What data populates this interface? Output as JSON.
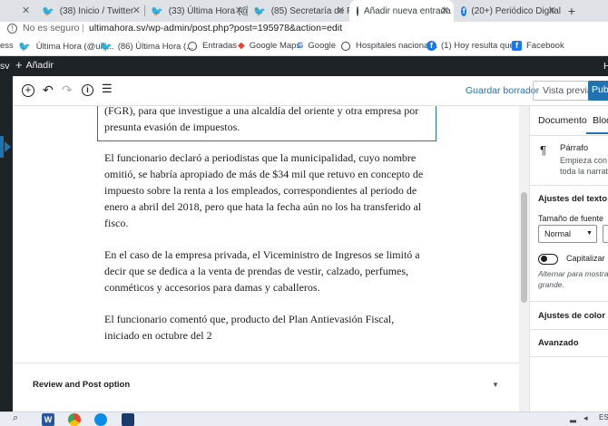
{
  "browser": {
    "tabs": [
      {
        "title": "(38) Inicio / Twitter",
        "icon": "twitter-icon"
      },
      {
        "title": "(33) Última Hora (@ult",
        "icon": "twitter-icon"
      },
      {
        "title": "(85) Secretaría de Pren",
        "icon": "twitter-icon"
      },
      {
        "title": "Añadir nueva entrada ‹",
        "icon": "wordpress-icon"
      },
      {
        "title": "(20+) Periódico Digital",
        "icon": "facebook-icon"
      }
    ],
    "new_tab": "+",
    "security_label": "No es seguro",
    "url": "ultimahora.sv/wp-admin/post.php?post=195978&action=edit",
    "bookmarks": [
      {
        "label": "ess"
      },
      {
        "label": "Última Hora (@ulti...",
        "icon": "twitter-icon"
      },
      {
        "label": "(86) Última Hora (...",
        "icon": "twitter-icon"
      },
      {
        "label": "Entradas",
        "icon": "wordpress-icon"
      },
      {
        "label": "Google Maps",
        "icon": "maps-icon"
      },
      {
        "label": "Google",
        "icon": "google-icon"
      },
      {
        "label": "Hospitales nacional...",
        "icon": "wordpress-icon"
      },
      {
        "label": "(1) Hoy resulta que...",
        "icon": "facebook-icon"
      },
      {
        "label": "Facebook",
        "icon": "facebook-icon"
      }
    ]
  },
  "admin_bar": {
    "left_fragment": "sv",
    "add_new": "Añadir",
    "right_fragment": "H"
  },
  "editor_header": {
    "save_draft": "Guardar borrador",
    "preview": "Vista previa",
    "publish": "Pub"
  },
  "content": {
    "selected_paragraph": "(FGR), para que investigue a una alcaldía del oriente y otra empresa por presunta evasión de impuestos.",
    "paragraphs": [
      "El funcionario declaró a periodistas que la municipalidad, cuyo nombre omitió, se habría apropiado de más de $34 mil que retuvo en concepto de impuesto sobre la renta a los empleados, correspondientes al periodo de enero a abril del 2018, pero que hata la fecha aún no los ha transferido al fisco.",
      "En el caso de la empresa privada, el Viceministro de Ingresos se limitó a decir que se dedica a la venta de prendas de vestir, calzado, perfumes, conméticos y accesorios para damas y caballeros.",
      "El funcionario comentó que, producto del Plan Antievasión Fiscal, iniciado en octubre del 2"
    ],
    "metabox_title": "Review and Post option"
  },
  "sidebar": {
    "tab_document": "Documento",
    "tab_block": "Bloq",
    "block_name": "Párrafo",
    "block_desc_1": "Empieza con el",
    "block_desc_2": "toda la narrativ",
    "text_settings": "Ajustes del texto",
    "font_size_label": "Tamaño de fuente",
    "font_size_value": "Normal",
    "dropcap_label": "Capitalizar",
    "dropcap_help_1": "Alternar para mostrar",
    "dropcap_help_2": "grande.",
    "color_settings": "Ajustes de color",
    "advanced": "Avanzado"
  },
  "taskbar": {
    "lang": "ES"
  },
  "colors": {
    "wp_blue": "#2271b1",
    "admin_bar": "#1d2327",
    "twitter": "#1d9bf0",
    "facebook": "#1877f2"
  }
}
